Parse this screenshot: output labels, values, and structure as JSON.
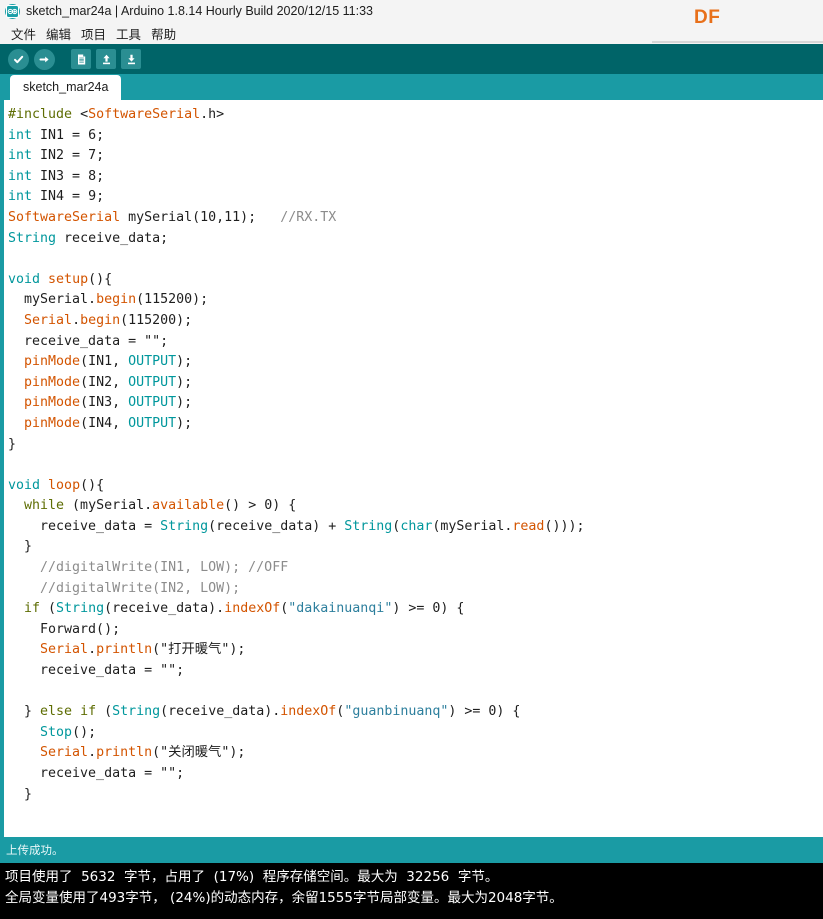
{
  "window": {
    "title": "sketch_mar24a | Arduino 1.8.14 Hourly Build 2020/12/15 11:33",
    "app_icon": "arduino-logo-icon",
    "brand": "DF"
  },
  "menubar": {
    "items": [
      {
        "label": "文件",
        "name": "menu-file"
      },
      {
        "label": "编辑",
        "name": "menu-edit"
      },
      {
        "label": "项目",
        "name": "menu-sketch"
      },
      {
        "label": "工具",
        "name": "menu-tools"
      },
      {
        "label": "帮助",
        "name": "menu-help"
      }
    ]
  },
  "toolbar": {
    "buttons": [
      {
        "name": "verify-button",
        "icon": "check-icon",
        "tooltip": "Verify"
      },
      {
        "name": "upload-button",
        "icon": "arrow-right-icon",
        "tooltip": "Upload"
      },
      {
        "name": "new-button",
        "icon": "new-file-icon",
        "tooltip": "New"
      },
      {
        "name": "open-button",
        "icon": "arrow-up-icon",
        "tooltip": "Open"
      },
      {
        "name": "save-button",
        "icon": "arrow-down-icon",
        "tooltip": "Save"
      }
    ]
  },
  "tabs": [
    {
      "label": "sketch_mar24a",
      "active": true
    }
  ],
  "editor": {
    "lines": [
      [
        [
          "#include ",
          "pre"
        ],
        [
          "<",
          "pl"
        ],
        [
          "SoftwareSerial",
          "fn"
        ],
        [
          ".h>",
          "pl"
        ]
      ],
      [
        [
          "int",
          "kw"
        ],
        [
          " IN1 = 6;",
          "pl"
        ]
      ],
      [
        [
          "int",
          "kw"
        ],
        [
          " IN2 = 7;",
          "pl"
        ]
      ],
      [
        [
          "int",
          "kw"
        ],
        [
          " IN3 = 8;",
          "pl"
        ]
      ],
      [
        [
          "int",
          "kw"
        ],
        [
          " IN4 = 9;",
          "pl"
        ]
      ],
      [
        [
          "SoftwareSerial",
          "fn"
        ],
        [
          " mySerial(10,11);   ",
          "pl"
        ],
        [
          "//RX.TX",
          "cm"
        ]
      ],
      [
        [
          "String",
          "kw"
        ],
        [
          " receive_data;",
          "pl"
        ]
      ],
      [
        [
          "",
          "pl"
        ]
      ],
      [
        [
          "void",
          "kw"
        ],
        [
          " ",
          "pl"
        ],
        [
          "setup",
          "fn"
        ],
        [
          "(){",
          "pl"
        ]
      ],
      [
        [
          "  mySerial.",
          "pl"
        ],
        [
          "begin",
          "fn"
        ],
        [
          "(115200);",
          "pl"
        ]
      ],
      [
        [
          "  ",
          "pl"
        ],
        [
          "Serial",
          "fn"
        ],
        [
          ".",
          "pl"
        ],
        [
          "begin",
          "fn"
        ],
        [
          "(115200);",
          "pl"
        ]
      ],
      [
        [
          "  receive_data = \"\";",
          "pl"
        ]
      ],
      [
        [
          "  ",
          "pl"
        ],
        [
          "pinMode",
          "fn"
        ],
        [
          "(IN1, ",
          "pl"
        ],
        [
          "OUTPUT",
          "kw"
        ],
        [
          ");",
          "pl"
        ]
      ],
      [
        [
          "  ",
          "pl"
        ],
        [
          "pinMode",
          "fn"
        ],
        [
          "(IN2, ",
          "pl"
        ],
        [
          "OUTPUT",
          "kw"
        ],
        [
          ");",
          "pl"
        ]
      ],
      [
        [
          "  ",
          "pl"
        ],
        [
          "pinMode",
          "fn"
        ],
        [
          "(IN3, ",
          "pl"
        ],
        [
          "OUTPUT",
          "kw"
        ],
        [
          ");",
          "pl"
        ]
      ],
      [
        [
          "  ",
          "pl"
        ],
        [
          "pinMode",
          "fn"
        ],
        [
          "(IN4, ",
          "pl"
        ],
        [
          "OUTPUT",
          "kw"
        ],
        [
          ");",
          "pl"
        ]
      ],
      [
        [
          "}",
          "pl"
        ]
      ],
      [
        [
          "",
          "pl"
        ]
      ],
      [
        [
          "void",
          "kw"
        ],
        [
          " ",
          "pl"
        ],
        [
          "loop",
          "fn"
        ],
        [
          "(){",
          "pl"
        ]
      ],
      [
        [
          "  ",
          "pl"
        ],
        [
          "while",
          "ctl"
        ],
        [
          " (mySerial.",
          "pl"
        ],
        [
          "available",
          "fn"
        ],
        [
          "() > 0) {",
          "pl"
        ]
      ],
      [
        [
          "    receive_data = ",
          "pl"
        ],
        [
          "String",
          "kw"
        ],
        [
          "(receive_data) + ",
          "pl"
        ],
        [
          "String",
          "kw"
        ],
        [
          "(",
          "pl"
        ],
        [
          "char",
          "kw"
        ],
        [
          "(mySerial.",
          "pl"
        ],
        [
          "read",
          "fn"
        ],
        [
          "()));",
          "pl"
        ]
      ],
      [
        [
          "  }",
          "pl"
        ]
      ],
      [
        [
          "    ",
          "pl"
        ],
        [
          "//digitalWrite(IN1, LOW); //OFF",
          "cm"
        ]
      ],
      [
        [
          "    ",
          "pl"
        ],
        [
          "//digitalWrite(IN2, LOW);",
          "cm"
        ]
      ],
      [
        [
          "  ",
          "pl"
        ],
        [
          "if",
          "ctl"
        ],
        [
          " (",
          "pl"
        ],
        [
          "String",
          "kw"
        ],
        [
          "(receive_data).",
          "pl"
        ],
        [
          "indexOf",
          "fn"
        ],
        [
          "(",
          "pl"
        ],
        [
          "\"dakainuanqi\"",
          "lit"
        ],
        [
          ") >= 0) {",
          "pl"
        ]
      ],
      [
        [
          "    Forward();",
          "pl"
        ]
      ],
      [
        [
          "    ",
          "pl"
        ],
        [
          "Serial",
          "fn"
        ],
        [
          ".",
          "pl"
        ],
        [
          "println",
          "fn"
        ],
        [
          "(",
          "pl"
        ],
        [
          "\"打开暖气\"",
          "str"
        ],
        [
          ");",
          "pl"
        ]
      ],
      [
        [
          "    receive_data = \"\";",
          "pl"
        ]
      ],
      [
        [
          "",
          "pl"
        ]
      ],
      [
        [
          "  } ",
          "pl"
        ],
        [
          "else",
          "ctl"
        ],
        [
          " ",
          "pl"
        ],
        [
          "if",
          "ctl"
        ],
        [
          " (",
          "pl"
        ],
        [
          "String",
          "kw"
        ],
        [
          "(receive_data).",
          "pl"
        ],
        [
          "indexOf",
          "fn"
        ],
        [
          "(",
          "pl"
        ],
        [
          "\"guanbinuanq\"",
          "lit"
        ],
        [
          ") >= 0) {",
          "pl"
        ]
      ],
      [
        [
          "    ",
          "pl"
        ],
        [
          "Stop",
          "kw"
        ],
        [
          "();",
          "pl"
        ]
      ],
      [
        [
          "    ",
          "pl"
        ],
        [
          "Serial",
          "fn"
        ],
        [
          ".",
          "pl"
        ],
        [
          "println",
          "fn"
        ],
        [
          "(",
          "pl"
        ],
        [
          "\"关闭暖气\"",
          "str"
        ],
        [
          ");",
          "pl"
        ]
      ],
      [
        [
          "    receive_data = \"\";",
          "pl"
        ]
      ],
      [
        [
          "  }",
          "pl"
        ]
      ]
    ]
  },
  "status": {
    "message": "上传成功。"
  },
  "console": {
    "lines": [
      "项目使用了  5632  字节，占用了  (17%)  程序存储空间。最大为  32256  字节。",
      "全局变量使用了493字节， (24%)的动态内存，余留1555字节局部变量。最大为2048字节。"
    ]
  },
  "colors": {
    "teal": "#1a9ba4",
    "dark_teal": "#006468",
    "toolbar_icon": "#2a8e92",
    "brand_orange": "#e8701a",
    "keyword": "#00979c",
    "function": "#d35400",
    "control": "#5e6d03",
    "comment": "#8c8c8c",
    "console_bg": "#000000"
  }
}
